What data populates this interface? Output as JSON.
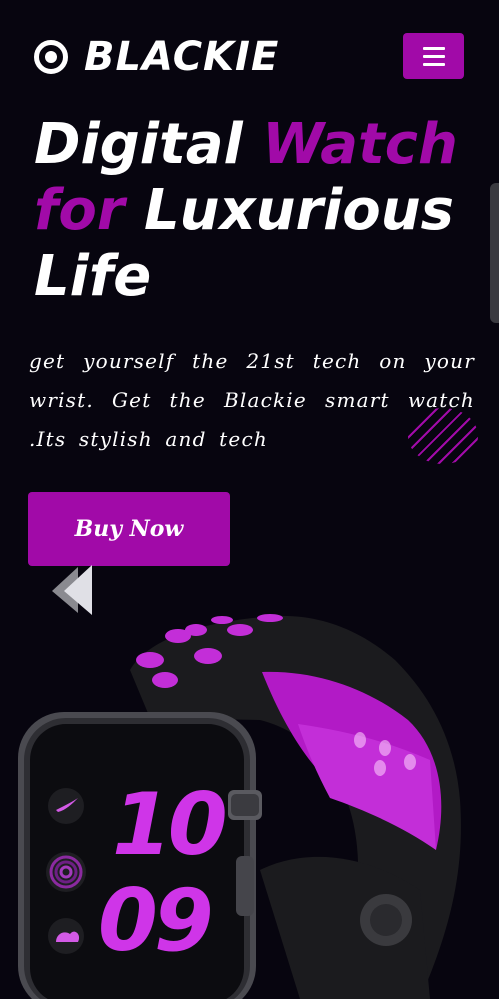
{
  "header": {
    "brand": "BLACKIE",
    "logo_icon": "target-icon",
    "menu_icon": "hamburger-menu-icon"
  },
  "hero": {
    "title_part1": "Digital ",
    "title_part2": "Watch",
    "title_part3": "for",
    "title_part4": " Luxurious",
    "title_part5": "Life",
    "description": "get yourself the 21st tech on your wrist. Get the Blackie smart watch .Its stylish and tech",
    "cta_label": "Buy Now"
  },
  "watch_face": {
    "hour": "10",
    "minute": "09"
  },
  "colors": {
    "accent": "#a10aa8",
    "background": "#07050f",
    "text": "#ffffff"
  }
}
